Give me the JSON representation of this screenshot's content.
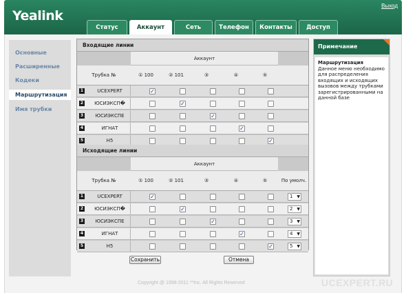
{
  "header": {
    "logo": "Yealink",
    "logout": "Выход",
    "tabs": [
      "Статус",
      "Аккаунт",
      "Сеть",
      "Телефон",
      "Контакты",
      "Доступ"
    ],
    "active_tab": "Аккаунт"
  },
  "sidebar": {
    "items": [
      "Основные",
      "Расширенные",
      "Кодеки",
      "Маршрутизация",
      "Имя трубки"
    ],
    "active": "Маршрутизация"
  },
  "incoming": {
    "title": "Входящие линии",
    "account_label": "Аккаунт",
    "handset_label": "Трубка №",
    "columns": [
      "① 100",
      "② 101",
      "③",
      "④",
      "⑤"
    ],
    "rows": [
      {
        "num": "1",
        "name": "UCEXPERT",
        "checks": [
          true,
          false,
          false,
          false,
          false
        ]
      },
      {
        "num": "2",
        "name": "ЮСИЭКСП�",
        "checks": [
          false,
          true,
          false,
          false,
          false
        ]
      },
      {
        "num": "3",
        "name": "ЮСИЭКСПЕ",
        "checks": [
          false,
          false,
          true,
          false,
          false
        ]
      },
      {
        "num": "4",
        "name": "ИГНАТ",
        "checks": [
          false,
          false,
          false,
          true,
          false
        ]
      },
      {
        "num": "5",
        "name": "H5",
        "checks": [
          false,
          false,
          false,
          false,
          true
        ]
      }
    ]
  },
  "outgoing": {
    "title": "Исходящие линии",
    "account_label": "Аккаунт",
    "handset_label": "Трубка №",
    "columns": [
      "① 100",
      "② 101",
      "③",
      "④",
      "⑤"
    ],
    "default_label": "По умолч.",
    "rows": [
      {
        "num": "1",
        "name": "UCEXPERT",
        "checks": [
          true,
          false,
          false,
          false,
          false
        ],
        "default": "1"
      },
      {
        "num": "2",
        "name": "ЮСИЭКСП�",
        "checks": [
          false,
          true,
          false,
          false,
          false
        ],
        "default": "2"
      },
      {
        "num": "3",
        "name": "ЮСИЭКСПЕ",
        "checks": [
          false,
          false,
          true,
          false,
          false
        ],
        "default": "3"
      },
      {
        "num": "4",
        "name": "ИГНАТ",
        "checks": [
          false,
          false,
          false,
          true,
          false
        ],
        "default": "4"
      },
      {
        "num": "5",
        "name": "H5",
        "checks": [
          false,
          false,
          false,
          false,
          true
        ],
        "default": "5"
      }
    ]
  },
  "buttons": {
    "save": "Сохранить",
    "cancel": "Отмена"
  },
  "note": {
    "header": "Примечание",
    "title": "Маршрутизация",
    "text": "Данное меню необходимо для распределения входящих и исходящих вызовов между трубками зарегистрированными на данной базе"
  },
  "footer": {
    "copyright": "Copyright @ 1998-2011 **Inc. All Rights Reserved",
    "watermark": "UCEXPERT.RU"
  },
  "colors": {
    "header_green": "#1f6e4e",
    "nav_text": "#6c88a7",
    "accent_orange": "#e8782a"
  }
}
